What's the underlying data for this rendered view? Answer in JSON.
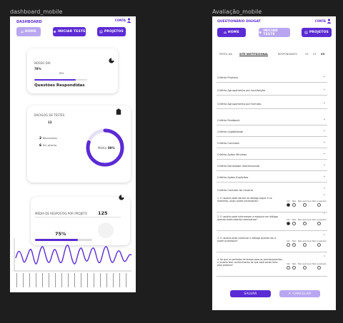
{
  "left_frame": {
    "label": "dashboard_mobile",
    "brand": "DASHBOARD",
    "user": "CONTA",
    "nav": {
      "home": "HOME",
      "new_test": "INICIAR TESTE",
      "projects": "PROJETOS"
    },
    "card1": {
      "title": "NOSSO DIA",
      "pct": "78%",
      "bubble": "78%",
      "heading": "Questões Respondidas",
      "progress": 0.78
    },
    "card2": {
      "title": "BACKLOG DE TESTES",
      "count": "12",
      "done_num": "2",
      "done_label": "Resolvidos",
      "todo_num": "6",
      "todo_label": "Em aberto",
      "ring_label": "Média",
      "ring_pct": "80%",
      "progress": 0.8
    },
    "card3": {
      "title": "MÉDIA DE RESPOSTAS POR PROJETO",
      "count": "125",
      "pct": "75%",
      "progress": 0.75
    }
  },
  "right_frame": {
    "label": "Avaliação_mobile",
    "brand": "QUESTIONÁRIO DIGIGAT",
    "user": "CONTA",
    "nav": {
      "home": "HOME",
      "new_test": "INICIAR TESTE",
      "projects": "PROJETOS"
    },
    "tabs": [
      "PERFIL DA",
      "SITE INSTITUCIONAL",
      "RESPONSÁVEIS"
    ],
    "pager": [
      "V2",
      "V1",
      "V3"
    ],
    "criteria": [
      "Critério Prioteus",
      "Critério Agrupamento por localização",
      "Critério Agrupamento por formato",
      "Critério Feedback",
      "Critério Legibilidade",
      "Critério Concisão",
      "Critério Ações Mínimas",
      "Critério Densidade Informacional",
      "Critério Ações Explícitas"
    ],
    "open_criterion": "Critério Controle do Usuário",
    "questions": [
      "1. O usuário pode decidir ao diálogo seguir e no momento, quais ações necessárias?",
      "2. O usuário pode interromper a máquina em diálogo quando estes estarão necessários?",
      "3. O usuário pode continuar o diálogo quando ele o puder prosseguir?",
      "4. Ao que os períodos de tempo para os processamentos, o usuário tem conhecimento do que está sendo feito pelo sistema?"
    ],
    "options": [
      "Sim",
      "Não",
      "Não aplicável",
      "Não analisado"
    ],
    "footer": {
      "save": "SALVAR",
      "cancel": "CANCELAR"
    }
  },
  "colors": {
    "accent": "#5b2bd4",
    "accent_light": "#b9a6f0",
    "background": "#1e1e1e"
  }
}
